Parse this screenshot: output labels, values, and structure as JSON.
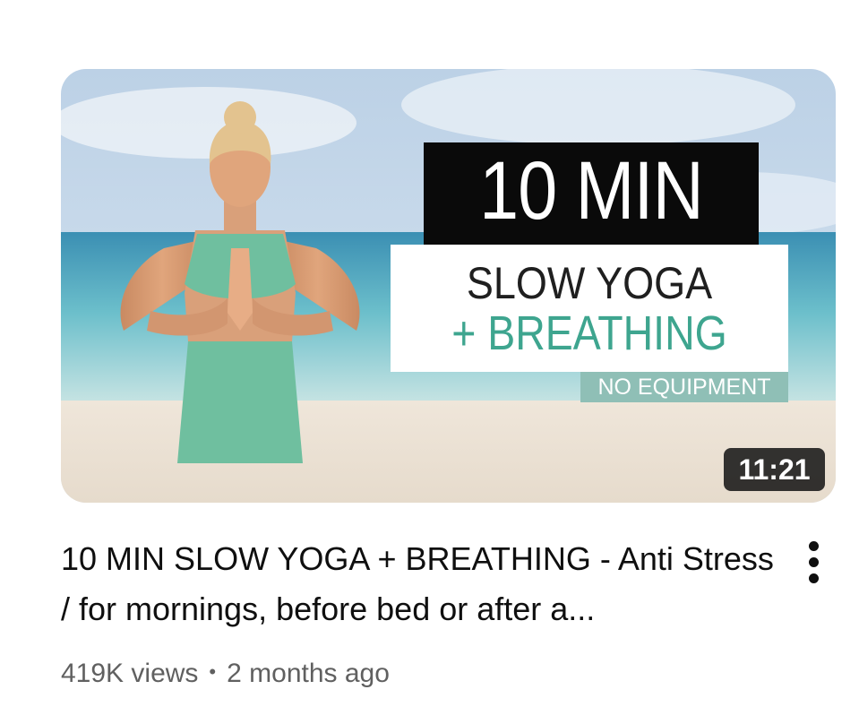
{
  "video": {
    "thumbnail": {
      "overlay_line1": "10 MIN",
      "overlay_line2": "SLOW YOGA",
      "overlay_line3": "+ BREATHING",
      "overlay_tag": "NO EQUIPMENT",
      "accent_color": "#3ea58f"
    },
    "duration": "11:21",
    "title": "10 MIN SLOW YOGA + BREATHING - Anti Stress / for mornings, before bed or after a...",
    "views": "419K views",
    "separator": "•",
    "age": "2 months ago",
    "menu_icon": "more-vert-icon"
  }
}
